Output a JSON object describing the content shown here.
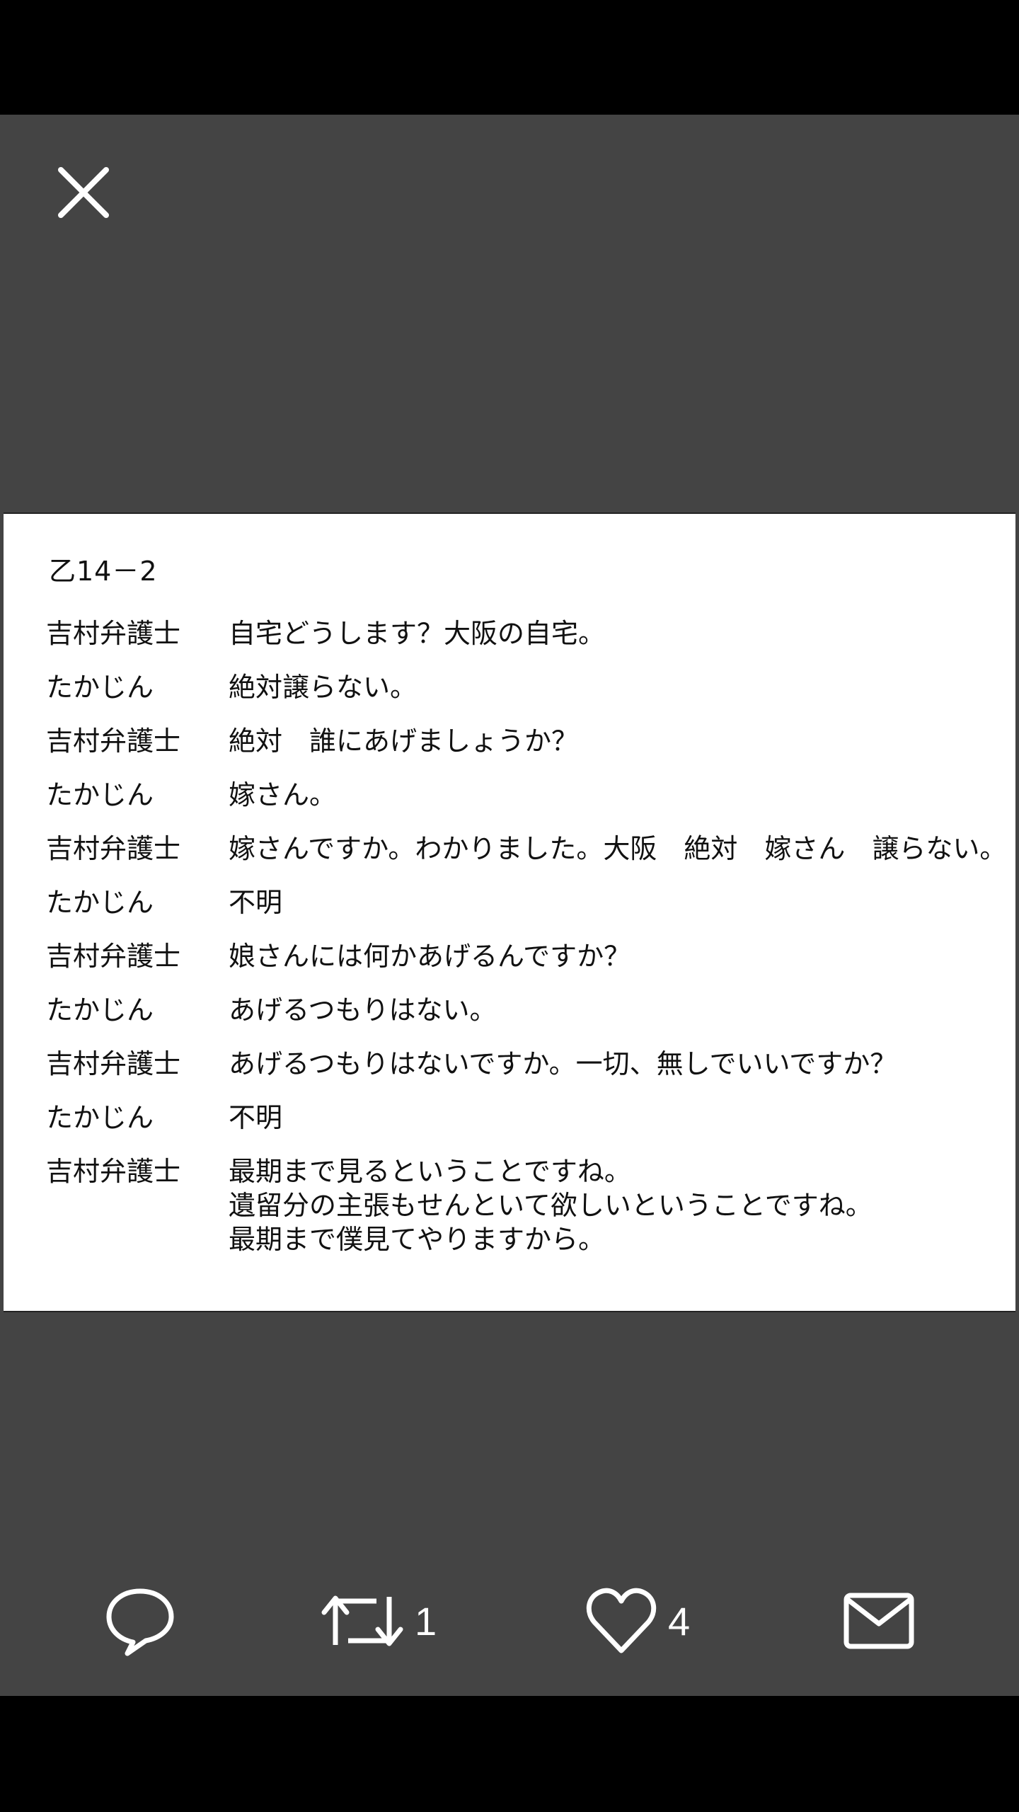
{
  "viewer": {
    "close_icon": "close-icon",
    "background": "#444444"
  },
  "document": {
    "title": "乙14－2",
    "rows": [
      {
        "speaker": "吉村弁護士",
        "lines": [
          "自宅どうします？大阪の自宅。"
        ]
      },
      {
        "speaker": "たかじん",
        "lines": [
          "絶対譲らない。"
        ]
      },
      {
        "speaker": "吉村弁護士",
        "lines": [
          "絶対　誰にあげましょうか？"
        ]
      },
      {
        "speaker": "たかじん",
        "lines": [
          "嫁さん。"
        ]
      },
      {
        "speaker": "吉村弁護士",
        "lines": [
          "嫁さんですか。わかりました。大阪　絶対　嫁さん　譲らない。"
        ]
      },
      {
        "speaker": "たかじん",
        "lines": [
          "不明"
        ]
      },
      {
        "speaker": "吉村弁護士",
        "lines": [
          "娘さんには何かあげるんですか？"
        ]
      },
      {
        "speaker": "たかじん",
        "lines": [
          "あげるつもりはない。"
        ]
      },
      {
        "speaker": "吉村弁護士",
        "lines": [
          "あげるつもりはないですか。一切、無しでいいですか？"
        ]
      },
      {
        "speaker": "たかじん",
        "lines": [
          "不明"
        ]
      },
      {
        "speaker": "吉村弁護士",
        "lines": [
          "最期まで見るということですね。",
          "遺留分の主張もせんといて欲しいということですね。",
          "最期まで僕見てやりますから。"
        ]
      }
    ]
  },
  "actions": {
    "reply": {
      "icon": "reply-icon",
      "count": ""
    },
    "retweet": {
      "icon": "retweet-icon",
      "count": "1"
    },
    "like": {
      "icon": "heart-icon",
      "count": "4"
    },
    "message": {
      "icon": "mail-icon",
      "count": ""
    }
  }
}
